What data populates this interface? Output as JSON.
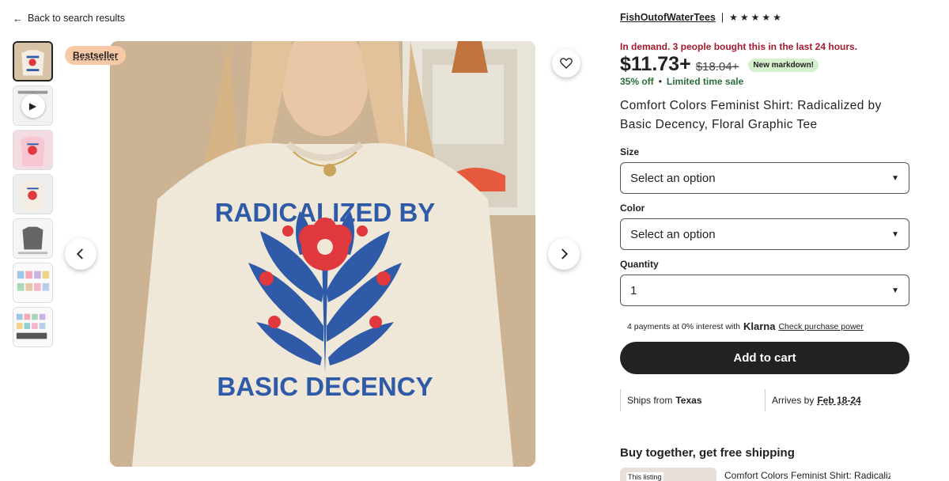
{
  "nav": {
    "back_label": "Back to search results"
  },
  "gallery": {
    "badge": "Bestseller",
    "main_text_top": "RADICALIZED BY",
    "main_text_bottom": "BASIC DECENCY"
  },
  "shop": {
    "name": "FishOutofWaterTees",
    "separator": "|",
    "rating_stars": 5
  },
  "demand": {
    "text": "In demand. 3 people bought this in the last 24 hours."
  },
  "price": {
    "current": "$11.73+",
    "original": "$18.04+",
    "markdown_label": "New markdown!",
    "discount": "35% off",
    "bullet": "•",
    "sale_label": "Limited time sale"
  },
  "title": "Comfort Colors Feminist Shirt: Radicalized by Basic Decency, Floral Graphic Tee",
  "options": {
    "size": {
      "label": "Size",
      "value": "Select an option"
    },
    "color": {
      "label": "Color",
      "value": "Select an option"
    },
    "quantity": {
      "label": "Quantity",
      "value": "1"
    }
  },
  "klarna": {
    "prefix": "4 payments at 0% interest with",
    "brand": "Klarna",
    "link": "Check purchase power"
  },
  "cart": {
    "label": "Add to cart"
  },
  "shipping": {
    "from_label": "Ships from",
    "from_value": "Texas",
    "arrives_label": "Arrives by",
    "arrives_value": "Feb 18-24"
  },
  "bundle": {
    "title": "Buy together, get free shipping",
    "tag": "This listing",
    "item_name": "Comfort Colors Feminist Shirt: Radicalized by Basic Decency"
  },
  "colors": {
    "accent_red": "#a61a2e",
    "sale_green": "#2a6e3a",
    "shirt_red": "#e0383c",
    "shirt_blue": "#2f5aa8"
  }
}
